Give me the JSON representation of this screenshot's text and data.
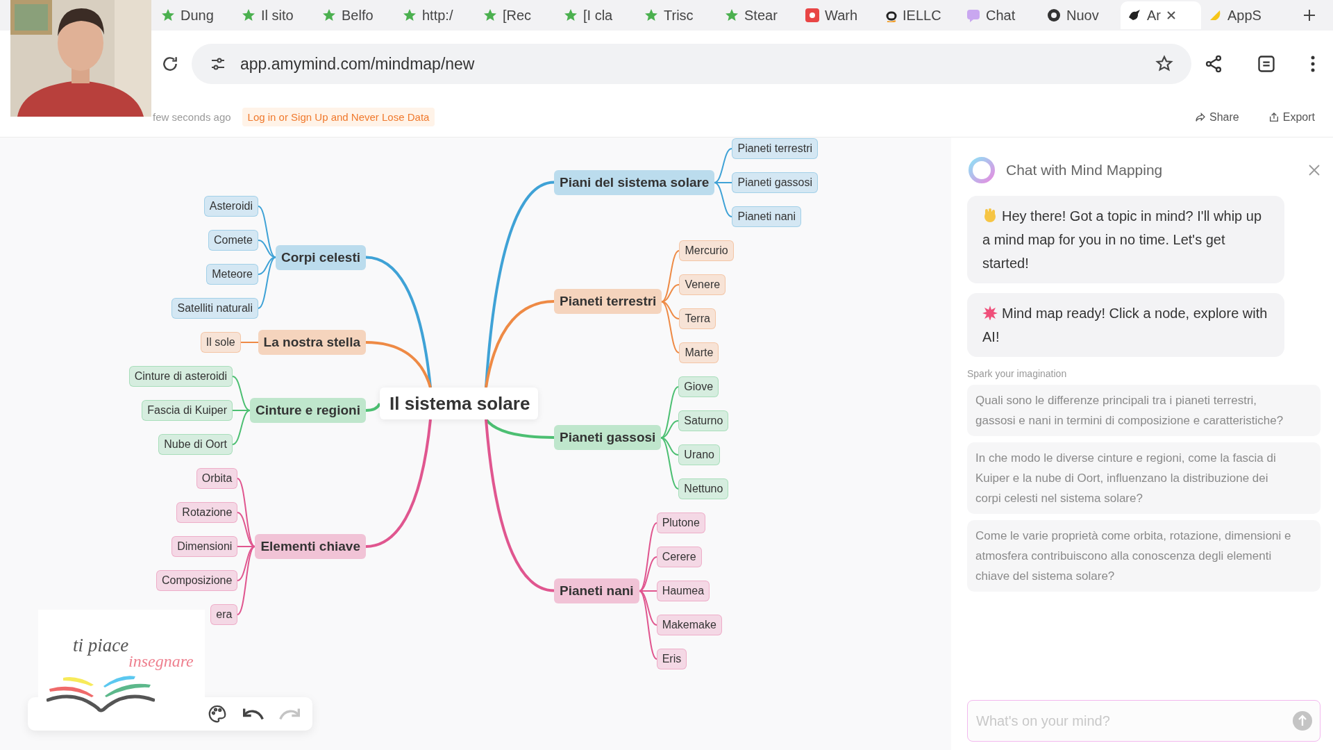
{
  "browser": {
    "tabs": [
      {
        "label": "Dung",
        "kind": "star",
        "selected": false
      },
      {
        "label": "Il sito",
        "kind": "star",
        "selected": false
      },
      {
        "label": "Belfo",
        "kind": "star",
        "selected": false
      },
      {
        "label": "http:/",
        "kind": "star",
        "selected": false
      },
      {
        "label": "[Rec",
        "kind": "star",
        "selected": false
      },
      {
        "label": "[I cla",
        "kind": "star",
        "selected": false
      },
      {
        "label": "Trisc",
        "kind": "star",
        "selected": false
      },
      {
        "label": "Stear",
        "kind": "star",
        "selected": false
      },
      {
        "label": "Warh",
        "kind": "badge",
        "selected": false
      },
      {
        "label": "IELLC",
        "kind": "letter",
        "selected": false
      },
      {
        "label": "Chat",
        "kind": "chat",
        "selected": false
      },
      {
        "label": "Nuov",
        "kind": "circle",
        "selected": false
      },
      {
        "label": "Ar",
        "kind": "bird",
        "selected": true
      },
      {
        "label": "AppS",
        "kind": "drop",
        "selected": false
      }
    ],
    "url": "app.amymind.com/mindmap/new"
  },
  "header": {
    "saved": "few seconds ago",
    "login_link": "Log in or Sign Up and Never Lose Data",
    "actions": [
      {
        "label": "Share",
        "kind": "share"
      },
      {
        "label": "Export",
        "kind": "export"
      }
    ]
  },
  "mindmap": {
    "root": "Il sistema solare",
    "left_branches": [
      {
        "label": "Corpi celesti",
        "color": "#3fa2d6",
        "children": [
          "Asteroidi",
          "Comete",
          "Meteore",
          "Satelliti naturali"
        ]
      },
      {
        "label": "La nostra stella",
        "color": "#ee8a45",
        "children": [
          "Il sole"
        ]
      },
      {
        "label": "Cinture e regioni",
        "color": "#4cbf72",
        "children": [
          "Cinture di asteroidi",
          "Fascia di Kuiper",
          "Nube di Oort"
        ]
      },
      {
        "label": "Elementi chiave",
        "color": "#e0568f",
        "children": [
          "Orbita",
          "Rotazione",
          "Dimensioni",
          "Composizione",
          "era"
        ]
      }
    ],
    "right_branches": [
      {
        "label": "Piani del sistema solare",
        "color": "#3fa2d6",
        "children": [
          "Pianeti terrestri",
          "Pianeti gassosi",
          "Pianeti nani"
        ]
      },
      {
        "label": "Pianeti terrestri",
        "color": "#ee8a45",
        "children": [
          "Mercurio",
          "Venere",
          "Terra",
          "Marte"
        ]
      },
      {
        "label": "Pianeti gassosi",
        "color": "#4cbf72",
        "children": [
          "Giove",
          "Saturno",
          "Urano",
          "Nettuno"
        ]
      },
      {
        "label": "Pianeti nani",
        "color": "#e0568f",
        "children": [
          "Plutone",
          "Cerere",
          "Haumea",
          "Makemake",
          "Eris"
        ]
      }
    ]
  },
  "toolbar": [
    {
      "kind": "palette",
      "disabled": false
    },
    {
      "kind": "undo",
      "disabled": false
    },
    {
      "kind": "redo",
      "disabled": true
    }
  ],
  "logo": {
    "line_1": "ti piace",
    "line_2": "insegnare"
  },
  "chat": {
    "title": "Chat with Mind Mapping",
    "messages": [
      {
        "kind": "wave",
        "text": "Hey there! Got a topic in mind? I'll whip up a mind map for you in no time. Let's get started!"
      },
      {
        "kind": "burst",
        "text": "Mind map ready! Click a node, explore with AI!"
      }
    ],
    "suggestions_label": "Spark your imagination",
    "suggestions": [
      "Quali sono le differenze principali tra i pianeti terrestri, gassosi e nani in termini di composizione e caratteristiche?",
      "In che modo le diverse cinture e regioni, come la fascia di Kuiper e la nube di Oort, influenzano la distribuzione dei corpi celesti nel sistema solare?",
      "Come le varie proprietà come orbita, rotazione, dimensioni e atmosfera contribuiscono alla conoscenza degli elementi chiave del sistema solare?"
    ],
    "input": {
      "placeholder": "What's on your mind?"
    }
  }
}
